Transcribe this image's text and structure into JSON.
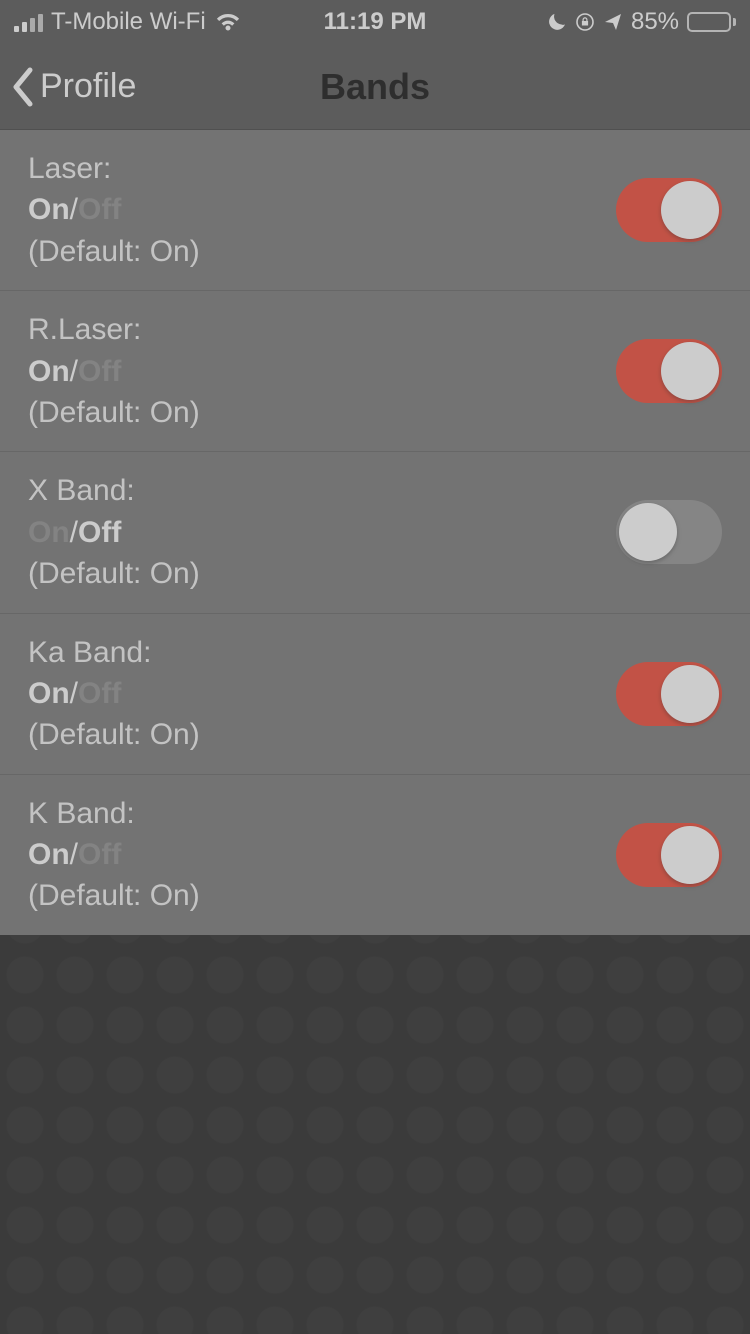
{
  "status": {
    "carrier": "T-Mobile Wi-Fi",
    "time": "11:19 PM",
    "battery_pct": "85%",
    "signal_active_bars": 2
  },
  "nav": {
    "back_label": "Profile",
    "title": "Bands"
  },
  "labels": {
    "on": "On",
    "off": "Off",
    "sep": "/",
    "default_prefix": "(Default: ",
    "default_suffix": ")"
  },
  "bands": [
    {
      "name": "Laser",
      "enabled": true,
      "default": "On"
    },
    {
      "name": "R.Laser",
      "enabled": true,
      "default": "On"
    },
    {
      "name": "X Band",
      "enabled": false,
      "default": "On"
    },
    {
      "name": "Ka Band",
      "enabled": true,
      "default": "On"
    },
    {
      "name": "K Band",
      "enabled": true,
      "default": "On"
    }
  ],
  "colors": {
    "accent": "#ef3b27",
    "list_bg": "#707070",
    "header_bg": "#4b4b4b"
  }
}
